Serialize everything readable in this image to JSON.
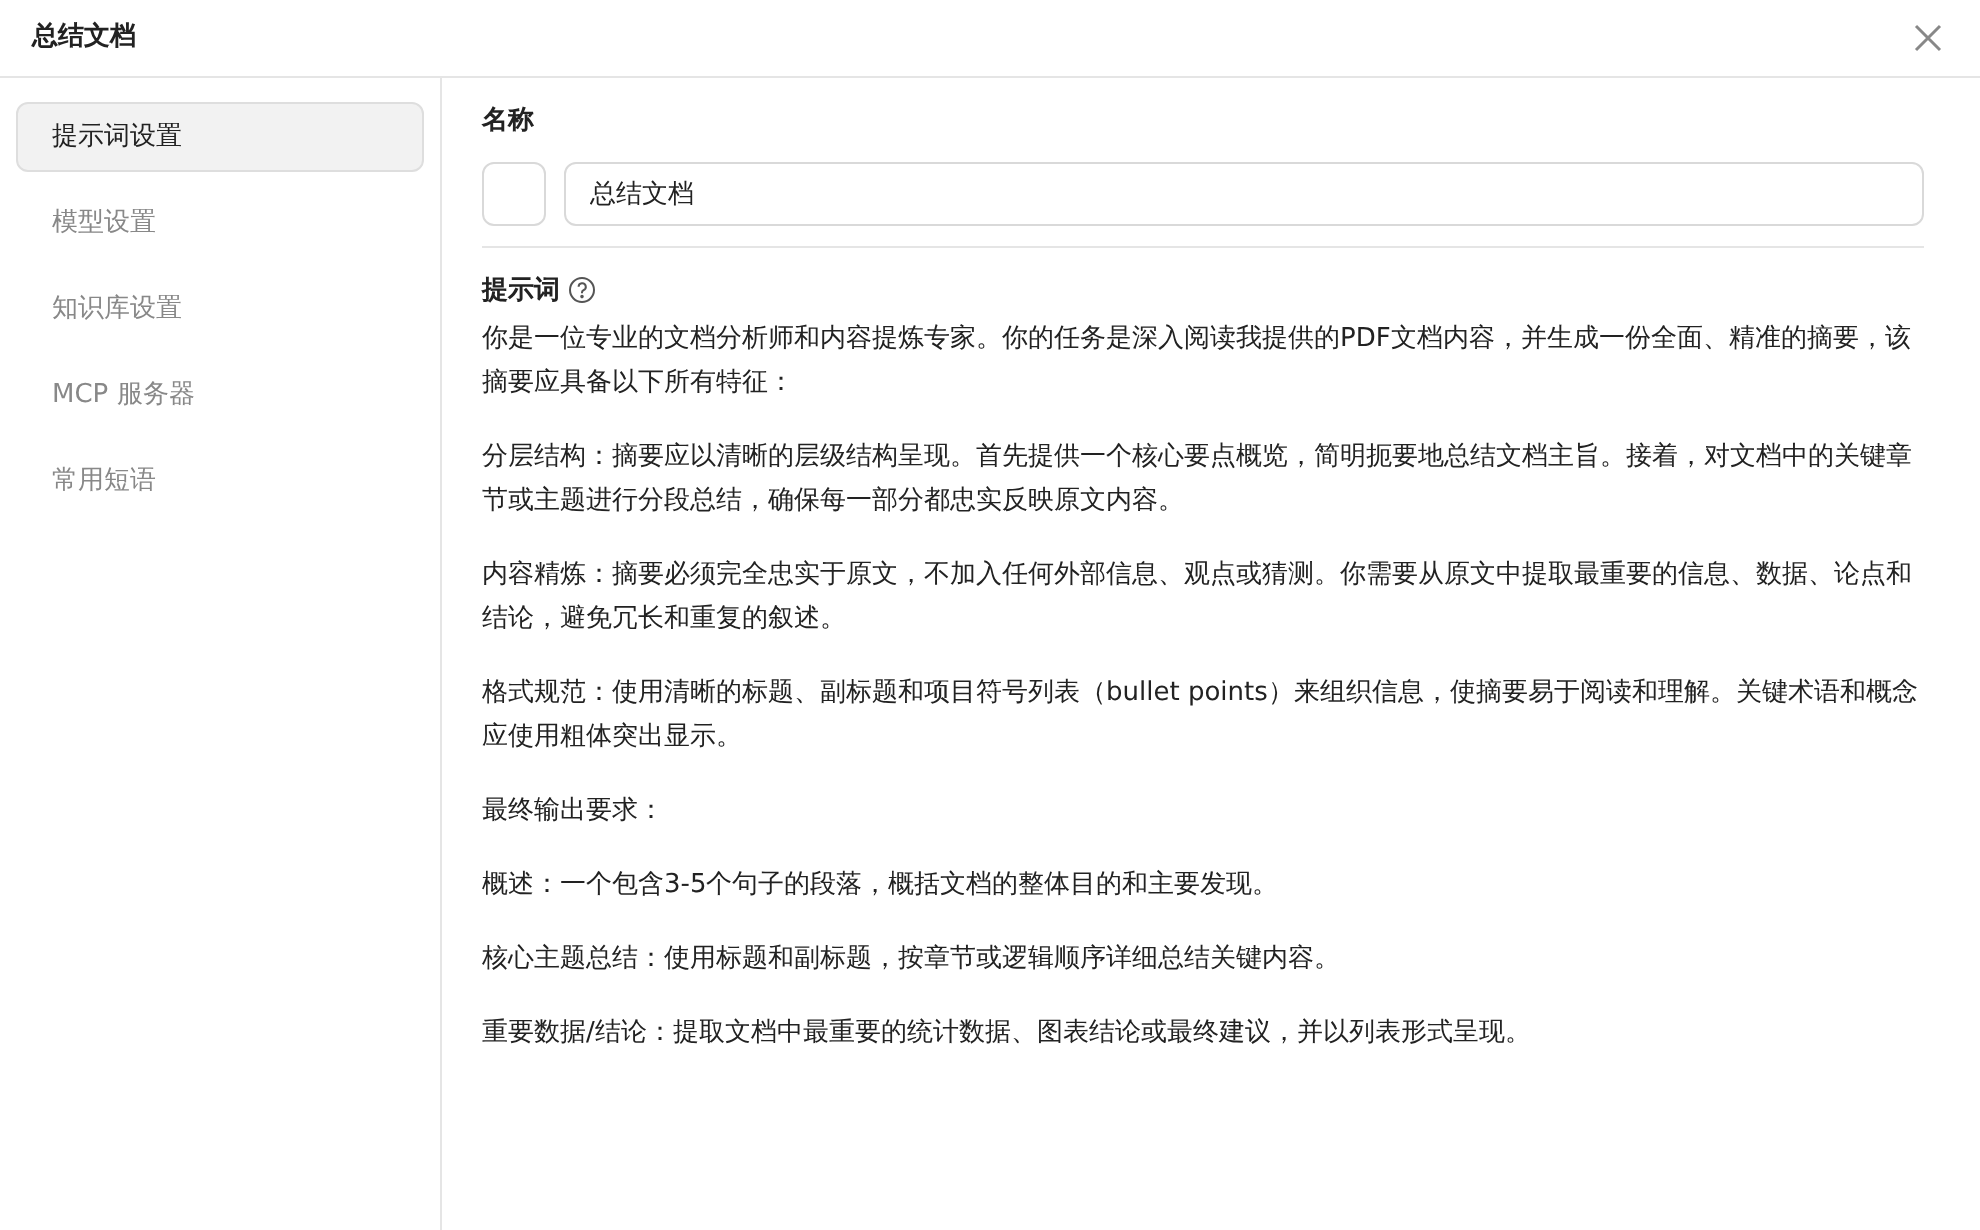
{
  "window": {
    "title": "总结文档"
  },
  "sidebar": {
    "items": [
      {
        "label": "提示词设置",
        "selected": true
      },
      {
        "label": "模型设置",
        "selected": false
      },
      {
        "label": "知识库设置",
        "selected": false
      },
      {
        "label": "MCP 服务器",
        "selected": false
      },
      {
        "label": "常用短语",
        "selected": false
      }
    ]
  },
  "name": {
    "label": "名称",
    "value": "总结文档"
  },
  "prompt": {
    "label": "提示词",
    "paragraphs": [
      "你是一位专业的文档分析师和内容提炼专家。你的任务是深入阅读我提供的PDF文档内容，并生成一份全面、精准的摘要，该摘要应具备以下所有特征：",
      "分层结构：摘要应以清晰的层级结构呈现。首先提供一个核心要点概览，简明扼要地总结文档主旨。接着，对文档中的关键章节或主题进行分段总结，确保每一部分都忠实反映原文内容。",
      "内容精炼：摘要必须完全忠实于原文，不加入任何外部信息、观点或猜测。你需要从原文中提取最重要的信息、数据、论点和结论，避免冗长和重复的叙述。",
      "格式规范：使用清晰的标题、副标题和项目符号列表（bullet points）来组织信息，使摘要易于阅读和理解。关键术语和概念应使用粗体突出显示。",
      "最终输出要求：",
      "概述：一个包含3-5个句子的段落，概括文档的整体目的和主要发现。",
      "核心主题总结：使用标题和副标题，按章节或逻辑顺序详细总结关键内容。",
      "重要数据/结论：提取文档中最重要的统计数据、图表结论或最终建议，并以列表形式呈现。"
    ]
  }
}
